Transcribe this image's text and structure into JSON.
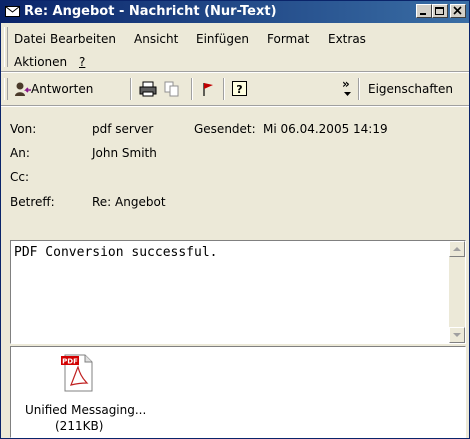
{
  "window": {
    "title": "Re: Angebot - Nachricht (Nur-Text)",
    "title_bar_color": "#0a246a",
    "face_color": "#ece9d8"
  },
  "menu": {
    "items": [
      "Datei",
      "Bearbeiten",
      "Ansicht",
      "Einfügen",
      "Format",
      "Extras",
      "Aktionen",
      "?"
    ]
  },
  "toolbar": {
    "reply_label": "Antworten",
    "properties_label": "Eigenschaften",
    "overflow_glyph": "»",
    "icons": [
      "reply-icon",
      "print-icon",
      "copy-icon",
      "flag-icon",
      "help-icon"
    ]
  },
  "header": {
    "from_label": "Von:",
    "from_value": "pdf server",
    "sent_label": "Gesendet:",
    "sent_value": "Mi 06.04.2005 14:19",
    "to_label": "An:",
    "to_value": "John Smith",
    "cc_label": "Cc:",
    "cc_value": "",
    "subject_label": "Betreff:",
    "subject_value": "Re: Angebot"
  },
  "message": {
    "body": "PDF Conversion successful."
  },
  "attachment": {
    "name": "Unified Messaging...",
    "size": "(211KB)",
    "icon": "pdf-file-icon",
    "icon_badge": "PDF"
  }
}
